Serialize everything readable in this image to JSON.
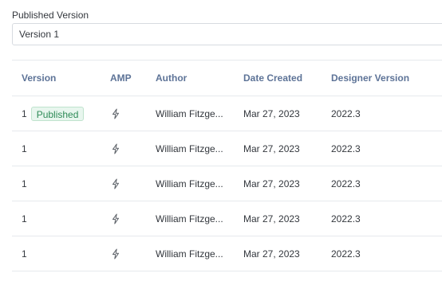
{
  "published_version": {
    "label": "Published Version",
    "selected": "Version 1"
  },
  "table": {
    "headers": {
      "version": "Version",
      "amp": "AMP",
      "author": "Author",
      "date_created": "Date Created",
      "designer_version": "Designer Version"
    },
    "rows": [
      {
        "version": "1",
        "badge": "Published",
        "amp_icon": "bolt-icon",
        "author": "William Fitzge...",
        "date_created": "Mar 27, 2023",
        "designer_version": "2022.3"
      },
      {
        "version": "1",
        "badge": "",
        "amp_icon": "bolt-icon",
        "author": "William Fitzge...",
        "date_created": "Mar 27, 2023",
        "designer_version": "2022.3"
      },
      {
        "version": "1",
        "badge": "",
        "amp_icon": "bolt-icon",
        "author": "William Fitzge...",
        "date_created": "Mar 27, 2023",
        "designer_version": "2022.3"
      },
      {
        "version": "1",
        "badge": "",
        "amp_icon": "bolt-icon",
        "author": "William Fitzge...",
        "date_created": "Mar 27, 2023",
        "designer_version": "2022.3"
      },
      {
        "version": "1",
        "badge": "",
        "amp_icon": "bolt-icon",
        "author": "William Fitzge...",
        "date_created": "Mar 27, 2023",
        "designer_version": "2022.3"
      }
    ]
  },
  "colors": {
    "header_text": "#5d7397",
    "badge_text": "#2e8b57",
    "badge_bg": "#e8f6ee"
  }
}
